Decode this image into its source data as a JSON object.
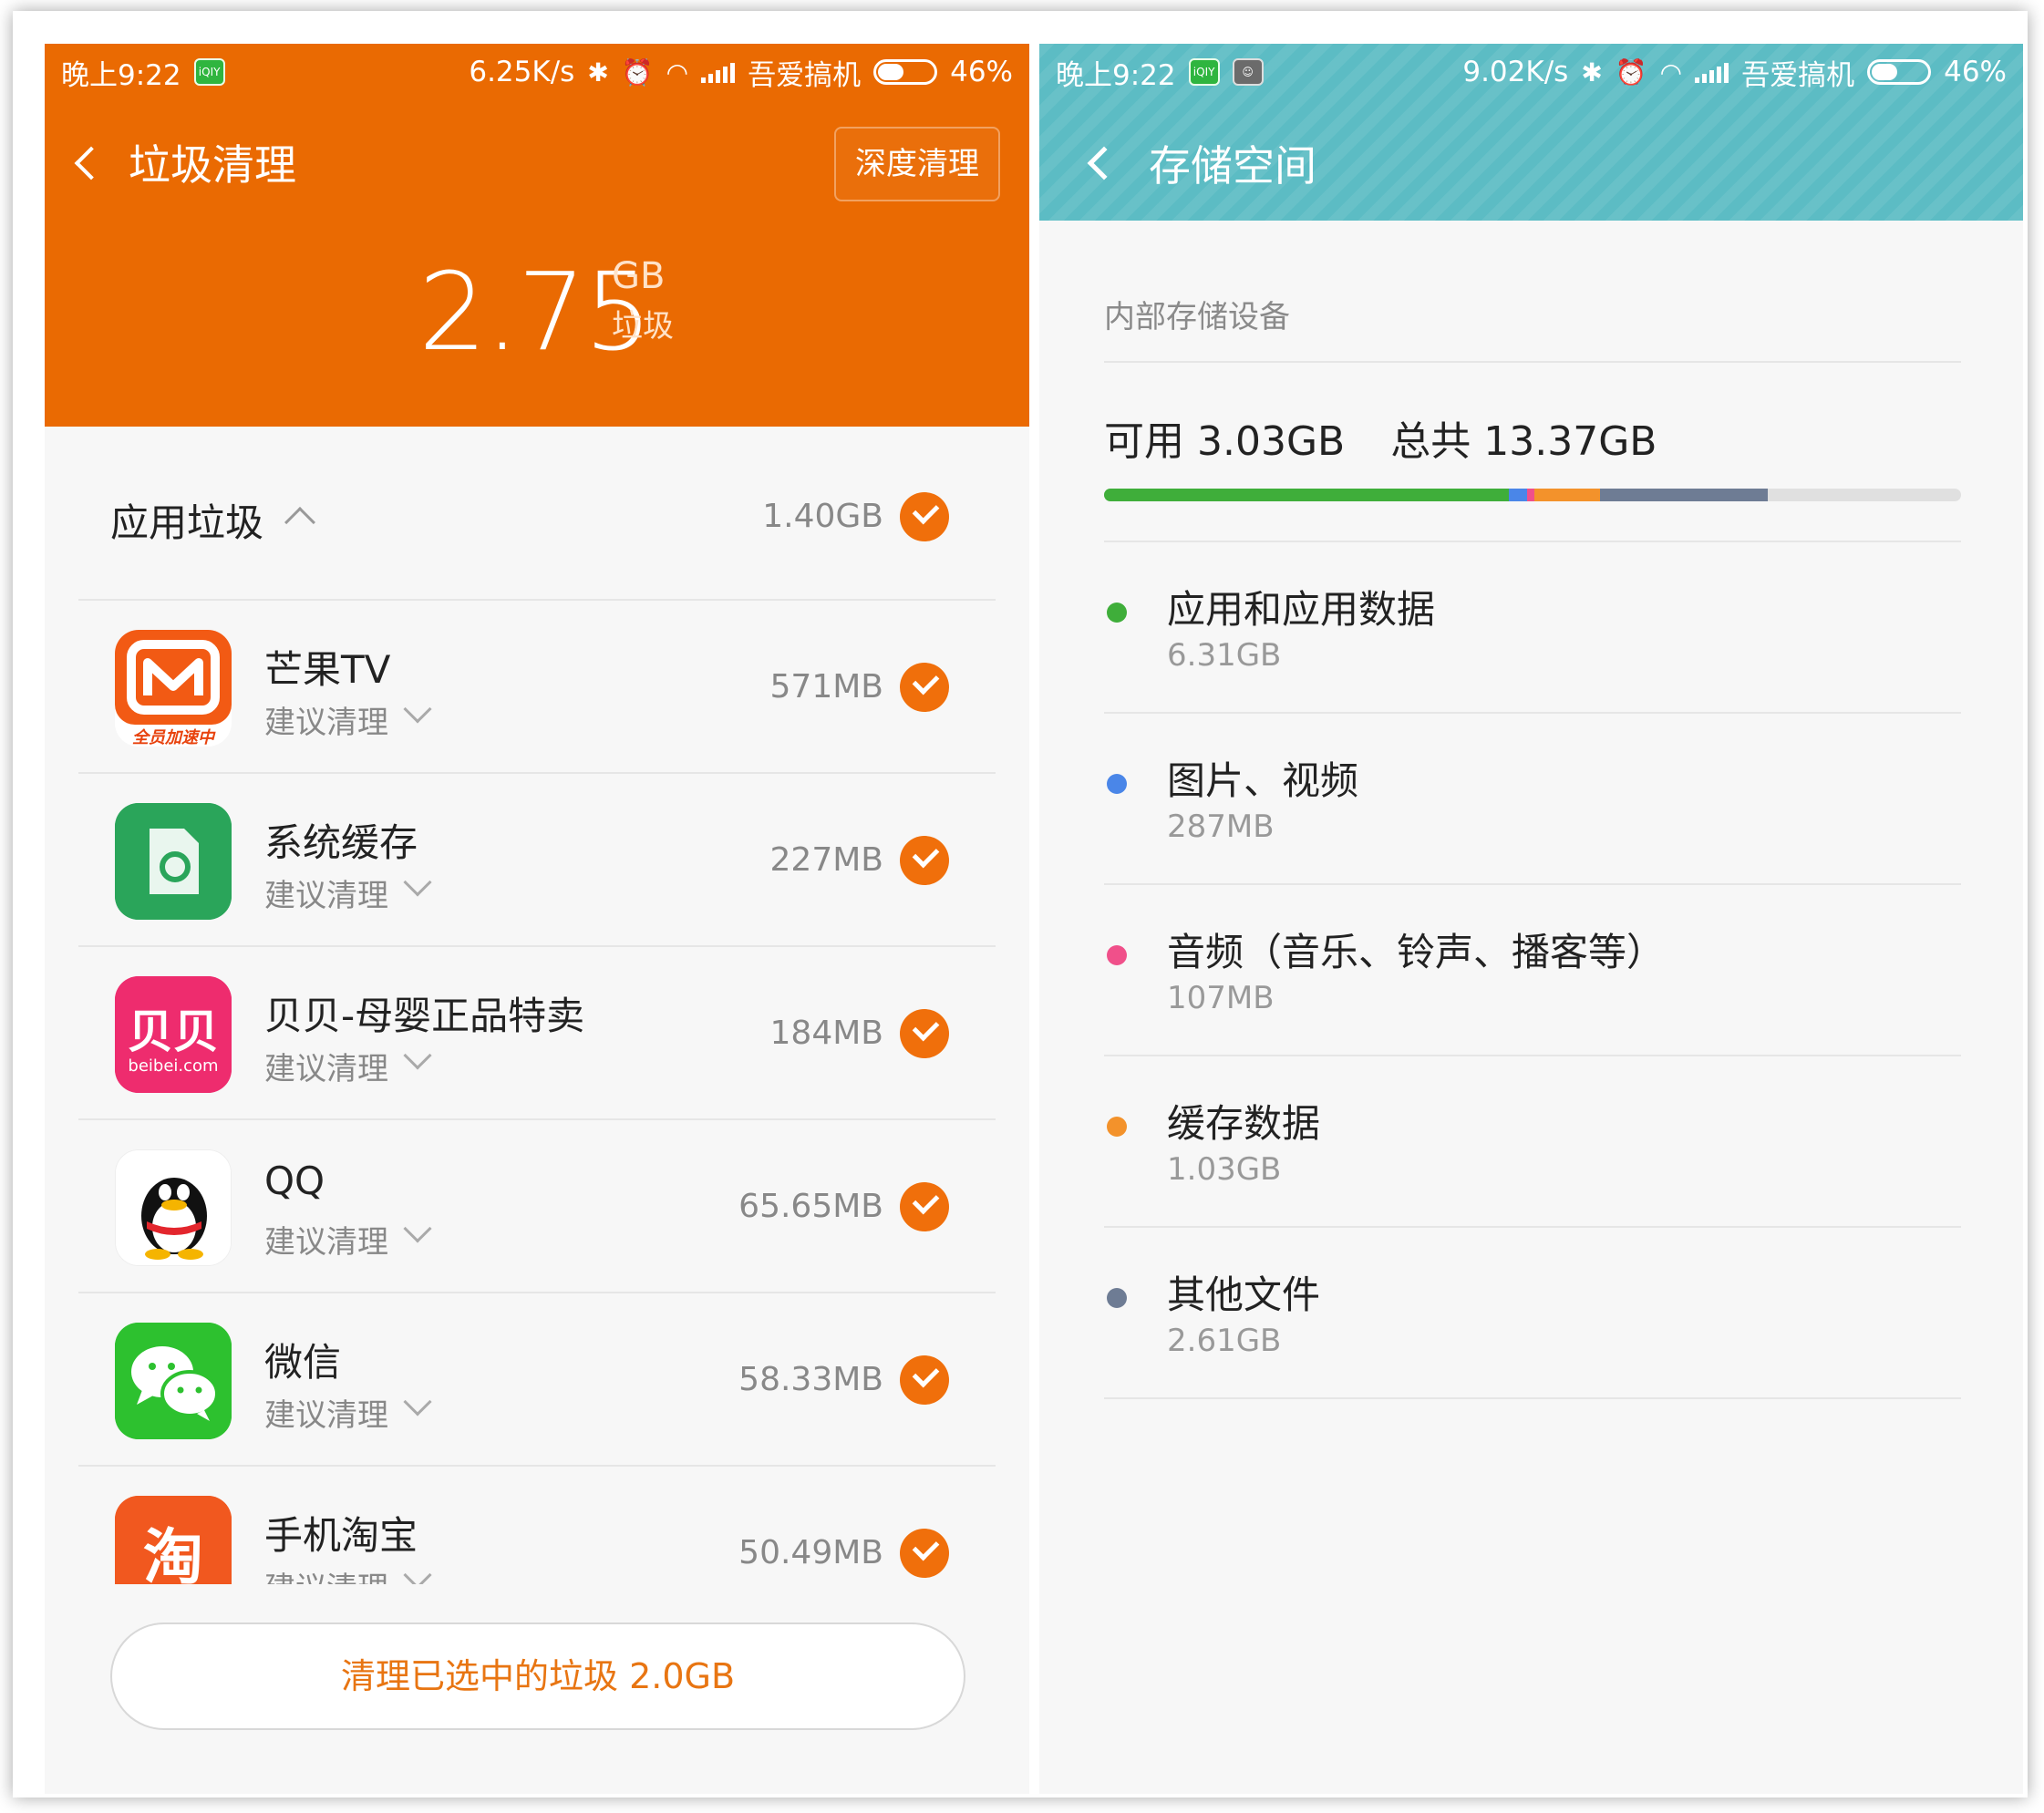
{
  "left": {
    "status": {
      "time": "晚上9:22",
      "speed": "6.25K/s",
      "carrier": "吾爱搞机",
      "battery": "46%",
      "battery_level": 0.46
    },
    "header": {
      "title": "垃圾清理",
      "deep_clean": "深度清理",
      "total_value": "2.75",
      "total_unit": "GB",
      "total_sub": "垃圾",
      "bg_color": "#EA6A02"
    },
    "group": {
      "label": "应用垃圾",
      "size": "1.40GB"
    },
    "apps": [
      {
        "name": "芒果TV",
        "sub": "建议清理",
        "size": "571MB",
        "icon": "mango-tv-icon"
      },
      {
        "name": "系统缓存",
        "sub": "建议清理",
        "size": "227MB",
        "icon": "system-cache-icon"
      },
      {
        "name": "贝贝-母婴正品特卖",
        "sub": "建议清理",
        "size": "184MB",
        "icon": "beibei-icon"
      },
      {
        "name": "QQ",
        "sub": "建议清理",
        "size": "65.65MB",
        "icon": "qq-icon"
      },
      {
        "name": "微信",
        "sub": "建议清理",
        "size": "58.33MB",
        "icon": "wechat-icon"
      },
      {
        "name": "手机淘宝",
        "sub": "建议清理",
        "size": "50.49MB",
        "icon": "taobao-icon"
      }
    ],
    "clean_button": "清理已选中的垃圾 2.0GB",
    "icon_text": {
      "mango_tag": "全员加速中",
      "beibei_mark": "贝贝",
      "beibei_domain": "beibei.com",
      "taobao_char": "淘"
    }
  },
  "right": {
    "status": {
      "time": "晚上9:22",
      "speed": "9.02K/s",
      "carrier": "吾爱搞机",
      "battery": "46%",
      "battery_level": 0.46
    },
    "header": {
      "title": "存储空间",
      "bg_color": "#5CBCC4"
    },
    "section_label": "内部存储设备",
    "available_text": "可用 3.03GB",
    "total_text": "总共 13.37GB",
    "categories": [
      {
        "name": "应用和应用数据",
        "size": "6.31GB",
        "color": "#3FAE3A",
        "gb": 6.31
      },
      {
        "name": "图片、视频",
        "size": "287MB",
        "color": "#4A86E8",
        "gb": 0.287
      },
      {
        "name": "音频（音乐、铃声、播客等）",
        "size": "107MB",
        "color": "#F0508A",
        "gb": 0.107
      },
      {
        "name": "缓存数据",
        "size": "1.03GB",
        "color": "#F3922B",
        "gb": 1.03
      },
      {
        "name": "其他文件",
        "size": "2.61GB",
        "color": "#6E7C94",
        "gb": 2.61
      }
    ],
    "total_gb": 13.37
  },
  "colors": {
    "accent_orange": "#F06F0B",
    "clean_button_text": "#E87512"
  }
}
